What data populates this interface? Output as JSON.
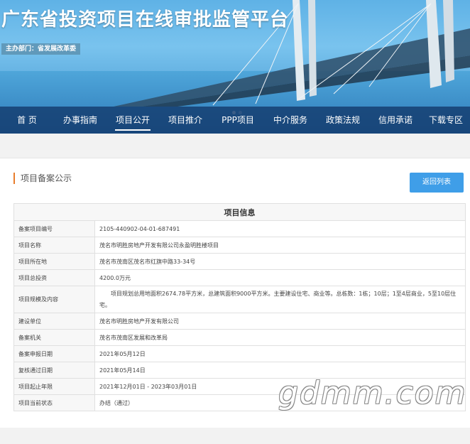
{
  "header": {
    "title": "广东省投资项目在线审批监管平台",
    "host_label": "主办部门：省发展改革委"
  },
  "nav": {
    "items": [
      {
        "label": "首 页"
      },
      {
        "label": "办事指南"
      },
      {
        "label": "项目公开"
      },
      {
        "label": "项目推介"
      },
      {
        "label": "PPP项目"
      },
      {
        "label": "中介服务"
      },
      {
        "label": "政策法规"
      },
      {
        "label": "信用承诺"
      },
      {
        "label": "下载专区"
      }
    ],
    "active": "项目公开"
  },
  "section": {
    "title": "项目备案公示",
    "back_label": "返回列表"
  },
  "table": {
    "header": "项目信息",
    "rows": [
      {
        "key": "备案项目编号",
        "value": "2105-440902-04-01-687491"
      },
      {
        "key": "项目名称",
        "value": "茂名市明胜房地产开发有限公司永盈明胜楼项目"
      },
      {
        "key": "项目所在地",
        "value": "茂名市茂南区茂名市红旗中路33-34号"
      },
      {
        "key": "项目总投资",
        "value": "4200.0万元"
      },
      {
        "key": "项目规模及内容",
        "value": "项目规划总用地面积2674.78平方米，总建筑面积9000平方米。主要建设住宅、商业等。总栋数：1栋；10层；1至4层商业，5至10层住宅。"
      },
      {
        "key": "建设单位",
        "value": "茂名市明胜房地产开发有限公司"
      },
      {
        "key": "备案机关",
        "value": "茂名市茂南区发展和改革局"
      },
      {
        "key": "备案申报日期",
        "value": "2021年05月12日"
      },
      {
        "key": "复核通过日期",
        "value": "2021年05月14日"
      },
      {
        "key": "项目起止年限",
        "value": "2021年12月01日 - 2023年03月01日"
      },
      {
        "key": "项目当前状态",
        "value": "办结（通过）"
      }
    ]
  },
  "watermark": "gdmm.com",
  "colors": {
    "nav_bg": "#143c6e",
    "button": "#3f9ee8",
    "accent_bar": "#e87c2b"
  }
}
